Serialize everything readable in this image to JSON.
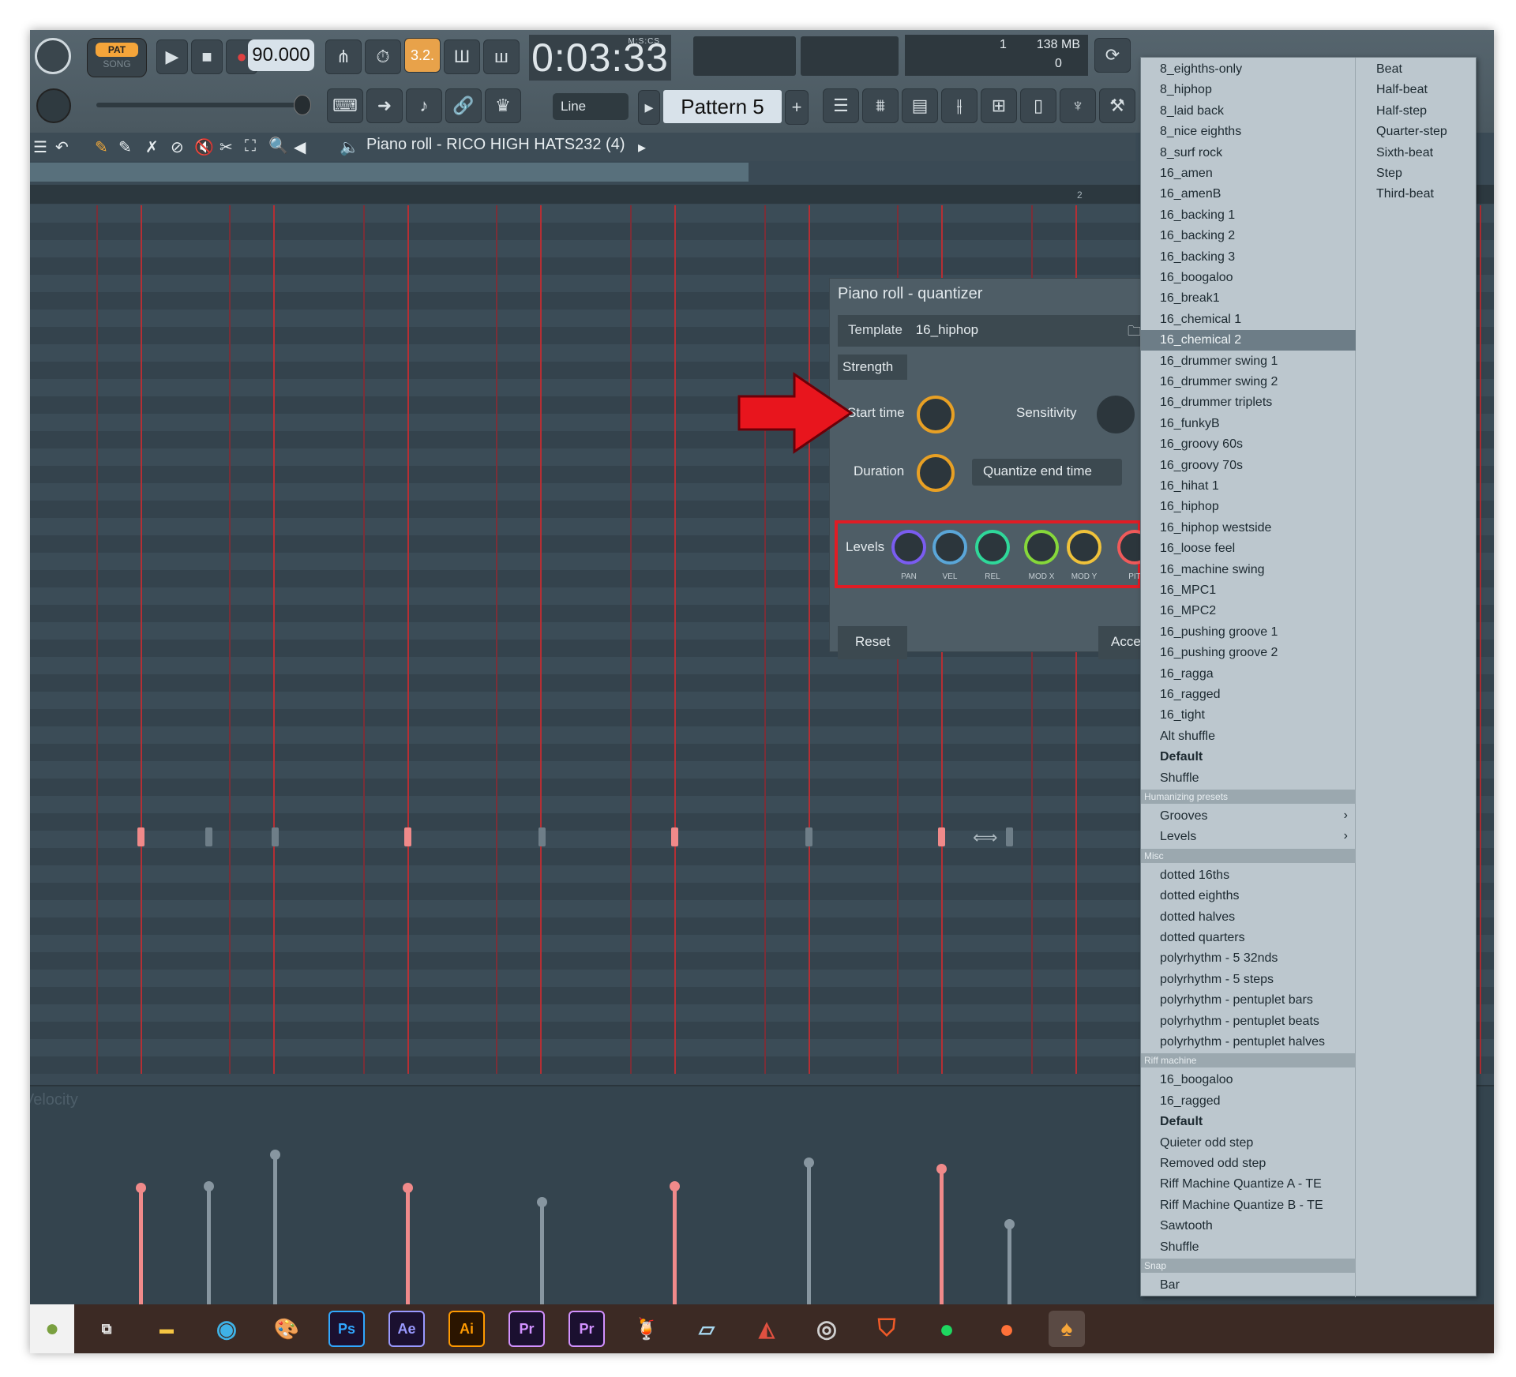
{
  "toolbar": {
    "pat_label": "PAT",
    "song_label": "SONG",
    "tempo": "90.000",
    "time": "0:03:33",
    "time_format": "M:S:CS",
    "cpu_value": "1",
    "memory": "138 MB",
    "poly_value": "0",
    "snap_mode": "Line",
    "pattern": "Pattern 5",
    "hot_button_label": "3.2."
  },
  "piano_roll": {
    "title": "Piano roll - RICO HIGH HATS232 (4)",
    "bar_marker": "2",
    "velocity_label": "Velocity"
  },
  "quantizer": {
    "title": "Piano roll - quantizer",
    "template_label": "Template",
    "template_value": "16_hiphop",
    "strength_tab": "Strength",
    "start_time_label": "Start time",
    "sensitivity_label": "Sensitivity",
    "duration_label": "Duration",
    "quantize_end_label": "Quantize end time",
    "levels_label": "Levels",
    "level_knobs": [
      "PAN",
      "VEL",
      "REL",
      "MOD X",
      "MOD Y",
      "PIT"
    ],
    "reset_label": "Reset",
    "accept_label": "Acce"
  },
  "menu": {
    "grooves_top": [
      "8_eighths-only",
      "8_hiphop",
      "8_laid back",
      "8_nice eighths",
      "8_surf rock",
      "16_amen",
      "16_amenB",
      "16_backing 1",
      "16_backing 2",
      "16_backing 3",
      "16_boogaloo",
      "16_break1",
      "16_chemical 1",
      "16_chemical 2",
      "16_drummer swing 1",
      "16_drummer swing 2",
      "16_drummer triplets",
      "16_funkyB",
      "16_groovy 60s",
      "16_groovy 70s",
      "16_hihat 1",
      "16_hiphop",
      "16_hiphop westside",
      "16_loose feel",
      "16_machine swing",
      "16_MPC1",
      "16_MPC2",
      "16_pushing groove 1",
      "16_pushing groove 2",
      "16_ragga",
      "16_ragged",
      "16_tight",
      "Alt shuffle",
      "Default",
      "Shuffle"
    ],
    "selected_item": "16_chemical 2",
    "section_humanizing": "Humanizing presets",
    "humanizing": [
      "Grooves",
      "Levels"
    ],
    "section_misc": "Misc",
    "misc": [
      "dotted 16ths",
      "dotted eighths",
      "dotted halves",
      "dotted quarters",
      "polyrhythm - 5 32nds",
      "polyrhythm - 5 steps",
      "polyrhythm - pentuplet bars",
      "polyrhythm - pentuplet beats",
      "polyrhythm - pentuplet halves"
    ],
    "section_riff": "Riff machine",
    "riff": [
      "16_boogaloo",
      "16_ragged",
      "Default",
      "Quieter odd step",
      "Removed odd step",
      "Riff Machine Quantize A - TE",
      "Riff Machine Quantize B - TE",
      "Sawtooth",
      "Shuffle"
    ],
    "section_snap": "Snap",
    "snap": [
      "Bar"
    ],
    "right_column": [
      "Beat",
      "Half-beat",
      "Half-step",
      "Quarter-step",
      "Sixth-beat",
      "Step",
      "Third-beat"
    ]
  },
  "taskbar": {
    "apps": [
      "task-view",
      "file-explorer",
      "edge",
      "paint",
      "photoshop",
      "after-effects",
      "illustrator",
      "premiere-pro",
      "premiere-rush",
      "fruit-app",
      "notes",
      "3d-app",
      "media-player",
      "brave",
      "spotify",
      "firefox",
      "fl-studio"
    ],
    "adobe_labels": [
      "Ps",
      "Ae",
      "Ai",
      "Pr",
      "Pr"
    ]
  },
  "colors": {
    "accent_orange": "#e8a024",
    "highlight_red": "#e01c25",
    "note_red": "#f08a8a"
  }
}
